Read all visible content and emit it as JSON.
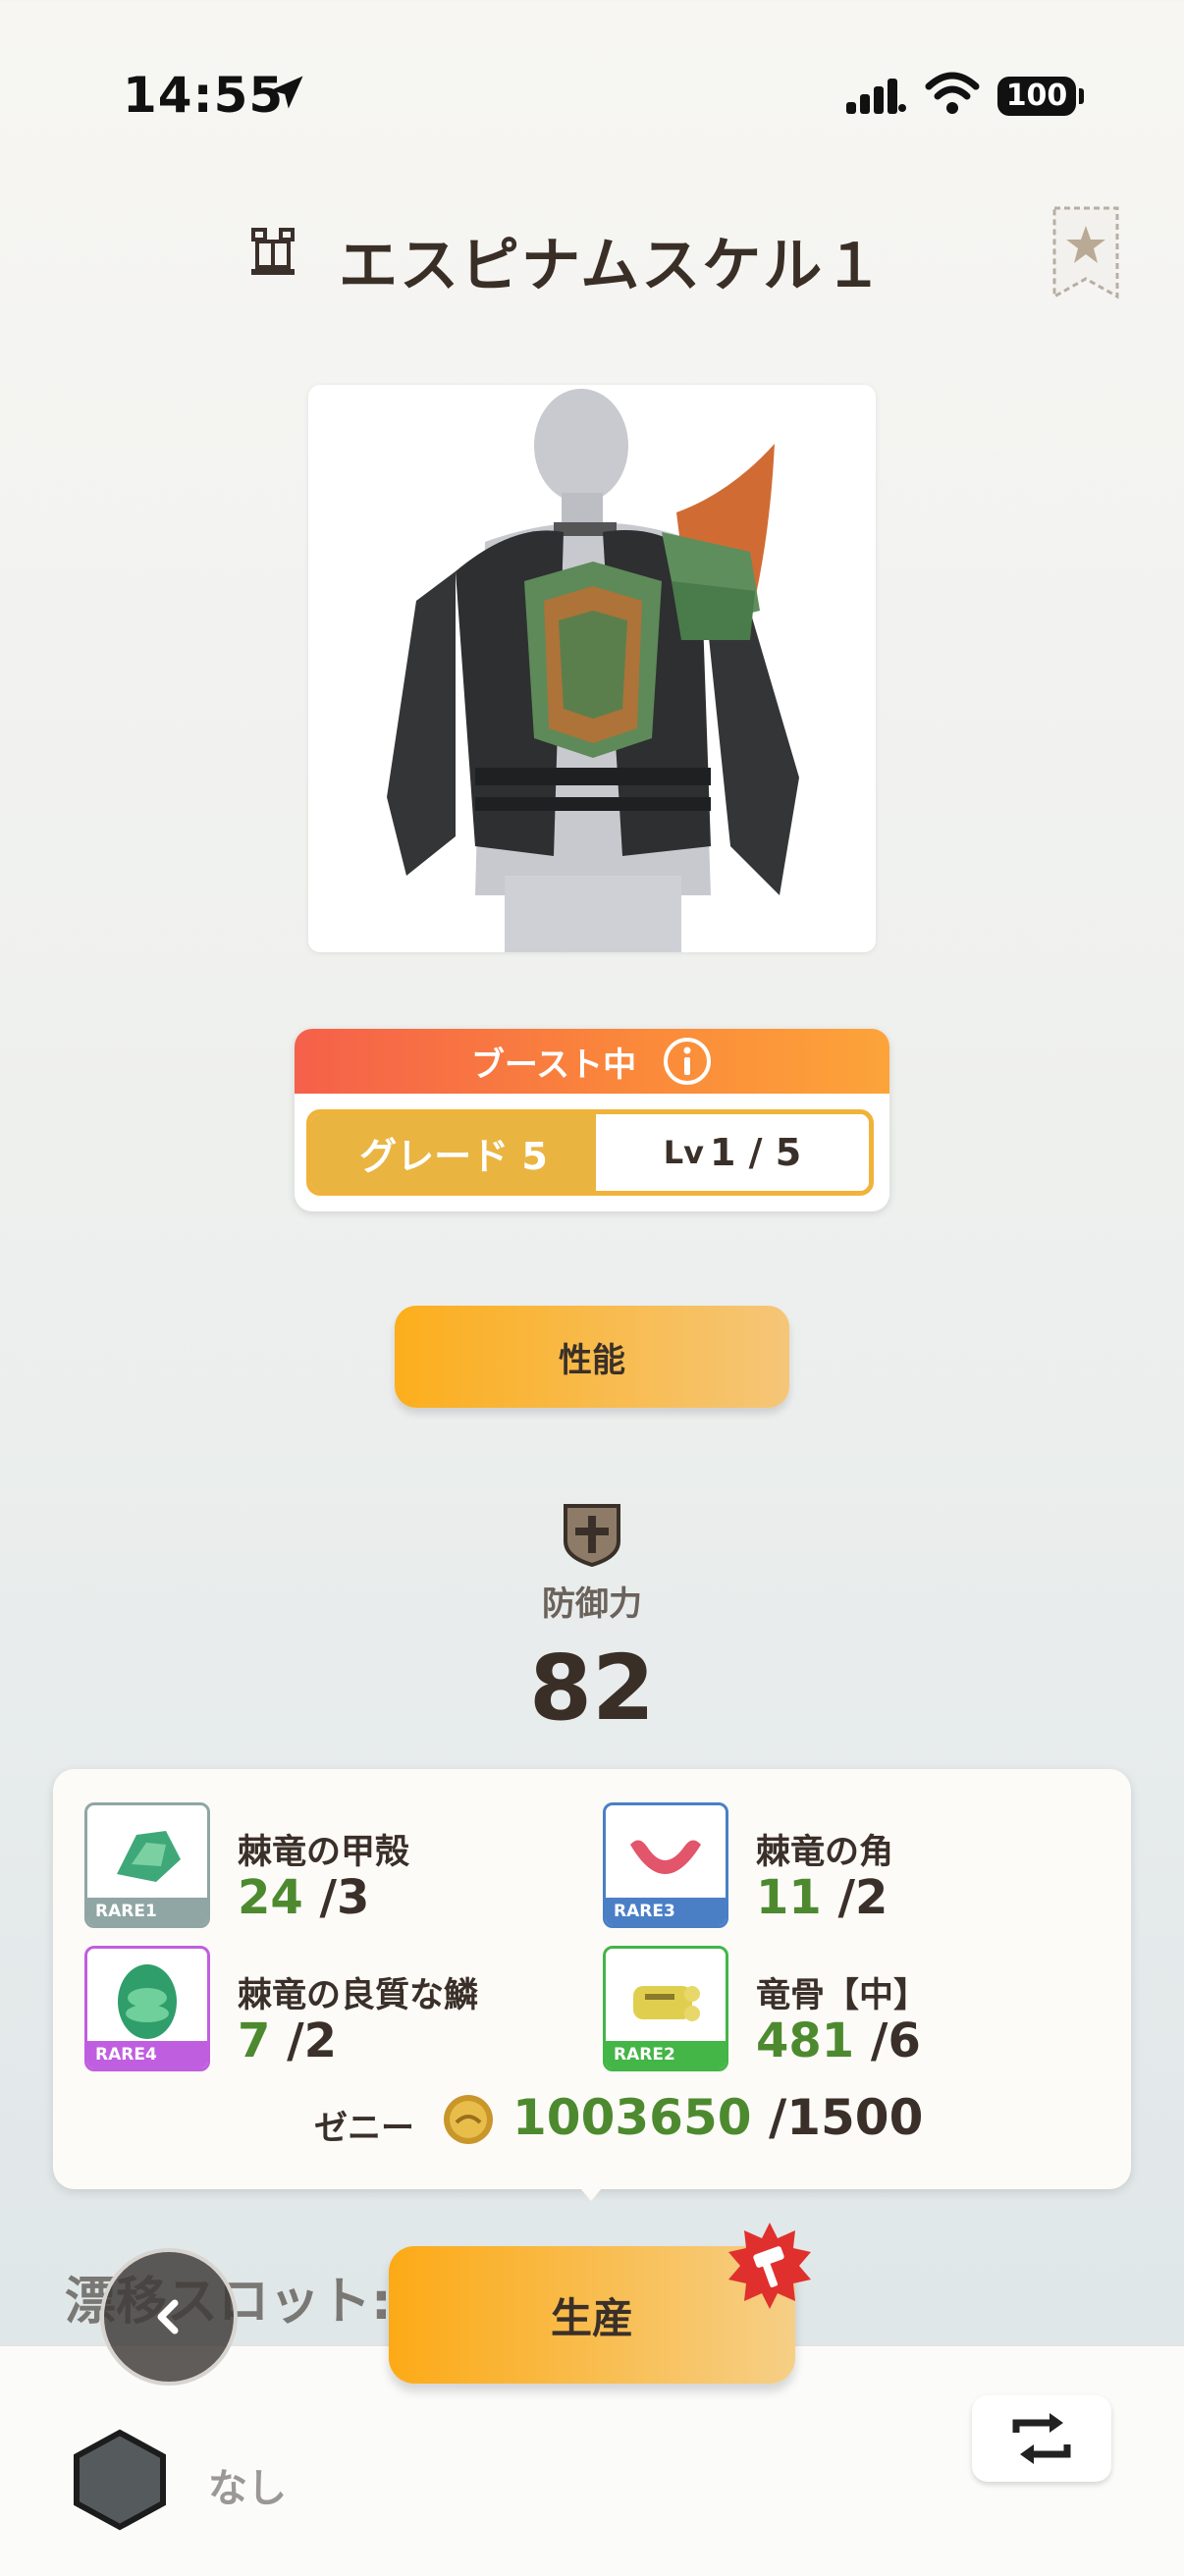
{
  "status_bar": {
    "time": "14:55",
    "battery": "100"
  },
  "header": {
    "title": "エスピナムスケル１",
    "favorite_icon": "star-bookmark-icon"
  },
  "boost": {
    "label": "ブースト中",
    "grade_label": "グレード 5",
    "level_prefix": "Lv",
    "level_value": "1 / 5"
  },
  "actions": {
    "performance_label": "性能",
    "produce_label": "生産"
  },
  "defense": {
    "label": "防御力",
    "value": "82"
  },
  "materials": [
    {
      "name": "棘竜の甲殻",
      "have": "24",
      "need": " /3",
      "rarity": "RARE1",
      "rarity_color": "#8fa6a4"
    },
    {
      "name": "棘竜の角",
      "have": "11",
      "need": " /2",
      "rarity": "RARE3",
      "rarity_color": "#4a7fc6"
    },
    {
      "name": "棘竜の良質な鱗",
      "have": "7",
      "need": " /2",
      "rarity": "RARE4",
      "rarity_color": "#c05ee0"
    },
    {
      "name": "竜骨【中】",
      "have": "481",
      "need": " /6",
      "rarity": "RARE2",
      "rarity_color": "#44b547"
    }
  ],
  "zeny": {
    "label": "ゼニー",
    "have": "1003650",
    "need": " /1500"
  },
  "slot": {
    "label": "漂移スロット:",
    "value": "なし"
  },
  "colors": {
    "accent_orange": "#fcae1c",
    "have_green": "#4d8a2f",
    "grade_gold": "#eab441",
    "boost_red": "#f5604a"
  }
}
